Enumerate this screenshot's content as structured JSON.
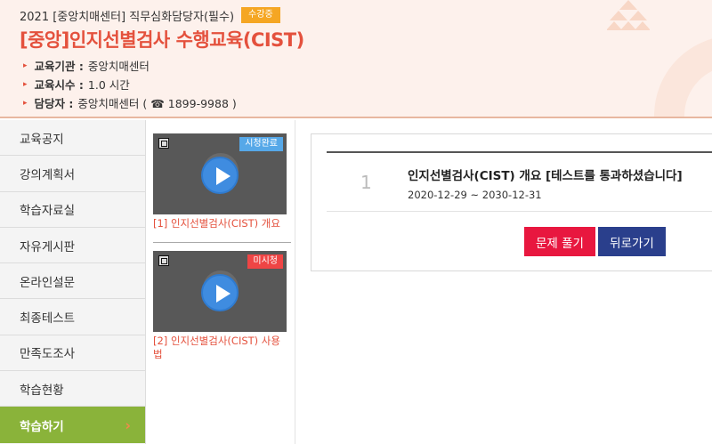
{
  "header": {
    "course_line": "2021 [중앙치매센터] 직무심화담당자(필수)",
    "badge": "수강중",
    "title": "[중앙]인지선별검사 수행교육(CIST)",
    "info": [
      {
        "label": "교육기관 :",
        "value": "중앙치매센터"
      },
      {
        "label": "교육시수 :",
        "value": "1.0 시간"
      },
      {
        "label": "담당자 :",
        "value": "중앙치매센터 ( ☎ 1899-9988 )"
      }
    ]
  },
  "sidebar": {
    "items": [
      {
        "label": "교육공지"
      },
      {
        "label": "강의계획서"
      },
      {
        "label": "학습자료실"
      },
      {
        "label": "자유게시판"
      },
      {
        "label": "온라인설문"
      },
      {
        "label": "최종테스트"
      },
      {
        "label": "만족도조사"
      },
      {
        "label": "학습현황"
      },
      {
        "label": "학습하기",
        "active": true,
        "chevron": "›"
      }
    ]
  },
  "videos": [
    {
      "status": "시청완료",
      "title": "[1] 인지선별검사(CIST) 개요"
    },
    {
      "status": "미시청",
      "title": "[2] 인지선별검사(CIST) 사용법"
    }
  ],
  "lesson": {
    "number": "1",
    "title": "인지선별검사(CIST) 개요 [테스트를 통과하셨습니다]",
    "period": "2020-12-29 ~ 2030-12-31",
    "solve_label": "문제 풀기",
    "back_label": "뒤로가기"
  },
  "colors": {
    "accent": "#e4513d",
    "badge": "#f5a623",
    "active_menu": "#8ab33a",
    "watched": "#56a8e8",
    "unwatched": "#ef4545",
    "solve_button": "#e8173f",
    "back_button": "#2a3f8c"
  },
  "icons": {
    "bullet": "small-triangle-icon",
    "active_arrow": "chevron-right-icon",
    "play": "play-icon"
  }
}
